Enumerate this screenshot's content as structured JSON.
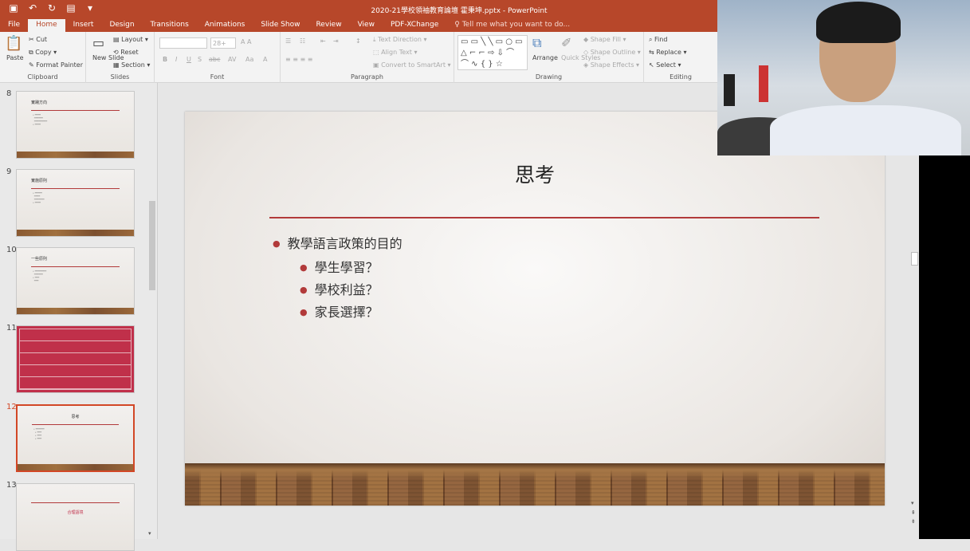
{
  "titlebar": {
    "title": "2020-21學校領袖教育論壇 霍秉坤.pptx - PowerPoint"
  },
  "tabs": [
    "File",
    "Home",
    "Insert",
    "Design",
    "Transitions",
    "Animations",
    "Slide Show",
    "Review",
    "View",
    "PDF-XChange"
  ],
  "tell_me": "Tell me what you want to do...",
  "ribbon": {
    "clipboard": {
      "label": "Clipboard",
      "paste": "Paste",
      "cut": "Cut",
      "copy": "Copy",
      "format_painter": "Format Painter"
    },
    "slides": {
      "label": "Slides",
      "new_slide": "New Slide",
      "layout": "Layout",
      "reset": "Reset",
      "section": "Section"
    },
    "font": {
      "label": "Font",
      "size": "28+"
    },
    "paragraph": {
      "label": "Paragraph",
      "text_direction": "Text Direction",
      "align_text": "Align Text",
      "convert": "Convert to SmartArt"
    },
    "drawing": {
      "label": "Drawing",
      "arrange": "Arrange",
      "quick_styles": "Quick Styles",
      "shape_fill": "Shape Fill",
      "shape_outline": "Shape Outline",
      "shape_effects": "Shape Effects"
    },
    "editing": {
      "label": "Editing",
      "find": "Find",
      "replace": "Replace",
      "select": "Select"
    }
  },
  "thumbnails": [
    {
      "num": "8",
      "title": "實踐方向"
    },
    {
      "num": "9",
      "title": "實施原則"
    },
    {
      "num": "10",
      "title": "一些原則"
    },
    {
      "num": "11",
      "title": ""
    },
    {
      "num": "12",
      "title": "思考"
    },
    {
      "num": "13",
      "title": "合理語境"
    }
  ],
  "slide": {
    "title": "思考",
    "bullet1": "教學語言政策的目的",
    "sub1": "學生學習？",
    "sub2": "學校利益？",
    "sub3": "家長選擇？"
  }
}
